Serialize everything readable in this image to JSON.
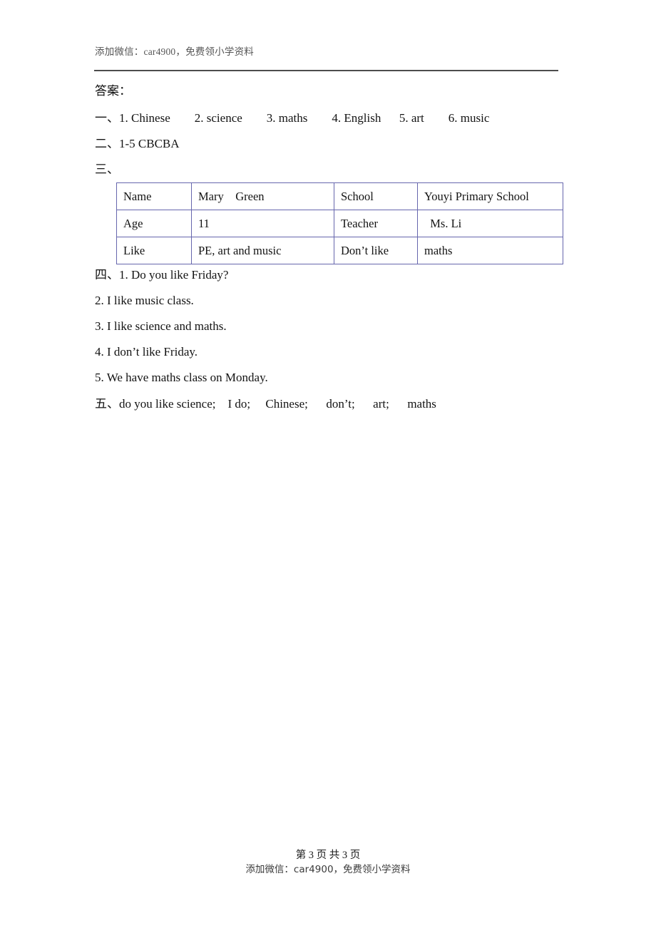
{
  "header": {
    "watermark": "添加微信：car4900，免费领小学资料"
  },
  "body": {
    "answer_heading": "答案：",
    "section_one": "一、1. Chinese        2. science        3. maths        4. English      5. art        6. music",
    "section_two": "二、1-5 CBCBA",
    "section_three_label": "三、",
    "section_four": "四、1. Do you like Friday?",
    "q2": "2. I like music class.",
    "q3": "3. I like science and maths.",
    "q4": "4. I don’t like Friday.",
    "q5": "5. We have maths class on Monday.",
    "section_five": "五、do you like science;    I do;     Chinese;      don’t;      art;      maths"
  },
  "table": {
    "border_color": "#6666ad",
    "rows": [
      {
        "label_a": "Name",
        "value_a": "Mary    Green",
        "label_b": "School",
        "value_b": "Youyi Primary School"
      },
      {
        "label_a": "Age",
        "value_a": "11",
        "label_b": "Teacher",
        "value_b": "  Ms. Li"
      },
      {
        "label_a": "Like",
        "value_a": "PE, art and music",
        "label_b": "Don’t like",
        "value_b": "maths"
      }
    ]
  },
  "footer": {
    "page_indicator": "第 3 页 共 3 页",
    "watermark": "添加微信：car4900，免费领小学资料"
  }
}
